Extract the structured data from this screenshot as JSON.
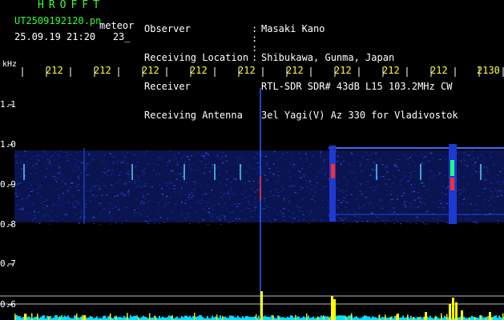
{
  "header": {
    "brand": "HROFFT",
    "file_name": "UT2509192120.pn",
    "file_tag": "meteor",
    "date_time": "25.09.19 21:20   23_",
    "labels": [
      "Observer",
      "Receiving Location",
      "Receiver",
      "Receiving Antenna"
    ],
    "values": [
      "Masaki Kano",
      "Shibukawa, Gunma, Japan",
      "RTL-SDR SDR# 43dB L15 103.2MHz CW",
      "3el Yagi(V) Az 330 for Vladivostok"
    ]
  },
  "axis": {
    "unit_label": "kHz",
    "time_labels": [
      "212",
      "212",
      "212",
      "212",
      "212",
      "212",
      "212",
      "212",
      "212",
      "2130"
    ],
    "freq_labels": [
      "1.1",
      "1.0",
      "0.9",
      "0.8",
      "0.7",
      "0.6"
    ]
  },
  "colors": {
    "background": "#000000",
    "brand": "#33ff33",
    "text": "#ffffff",
    "time_labels": "#ffff33",
    "signal_band": "#1a2aa0",
    "power_trace": "#ffff00",
    "noise_floor": "#00ffff"
  }
}
